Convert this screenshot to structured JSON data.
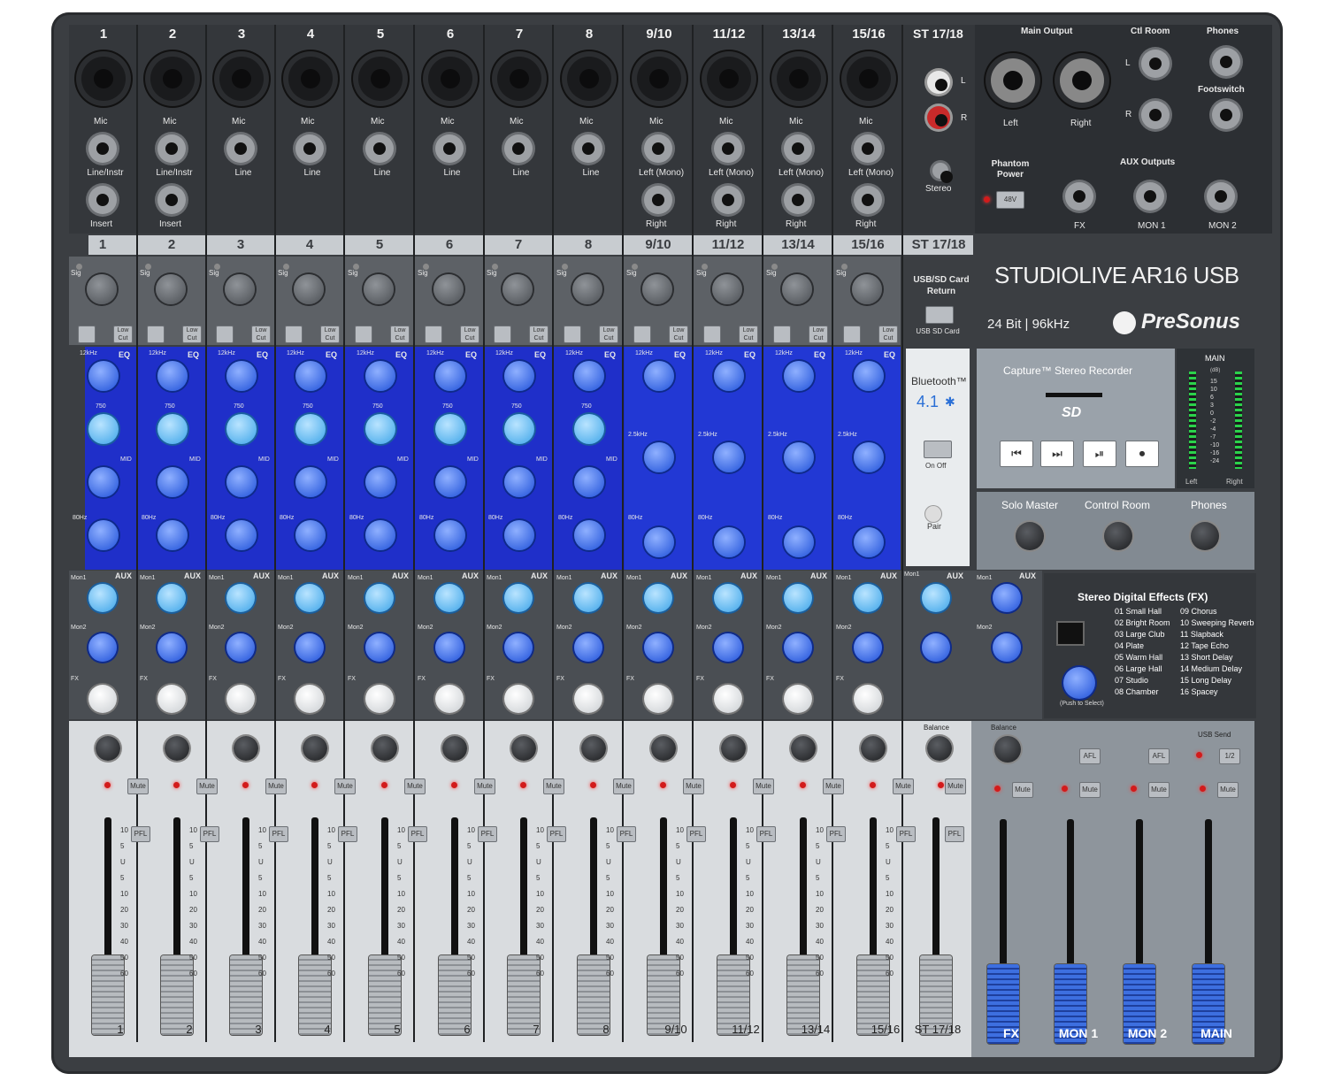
{
  "brand": {
    "model_prefix": "STUDIO",
    "model_suffix": "LIVE AR16 USB",
    "spec": "24 Bit | 96kHz",
    "maker": "PreSonus"
  },
  "channels": [
    {
      "label": "1",
      "inputs": [
        "Mic",
        "Line/Instr",
        "Insert"
      ],
      "fader": "1"
    },
    {
      "label": "2",
      "inputs": [
        "Mic",
        "Line/Instr",
        "Insert"
      ],
      "fader": "2"
    },
    {
      "label": "3",
      "inputs": [
        "Mic",
        "Line"
      ],
      "fader": "3"
    },
    {
      "label": "4",
      "inputs": [
        "Mic",
        "Line"
      ],
      "fader": "4"
    },
    {
      "label": "5",
      "inputs": [
        "Mic",
        "Line"
      ],
      "fader": "5"
    },
    {
      "label": "6",
      "inputs": [
        "Mic",
        "Line"
      ],
      "fader": "6"
    },
    {
      "label": "7",
      "inputs": [
        "Mic",
        "Line"
      ],
      "fader": "7"
    },
    {
      "label": "8",
      "inputs": [
        "Mic",
        "Line"
      ],
      "fader": "8"
    },
    {
      "label": "9/10",
      "inputs": [
        "Mic",
        "Left (Mono)",
        "Right"
      ],
      "fader": "9/10"
    },
    {
      "label": "11/12",
      "inputs": [
        "Mic",
        "Left (Mono)",
        "Right"
      ],
      "fader": "11/12"
    },
    {
      "label": "13/14",
      "inputs": [
        "Mic",
        "Left (Mono)",
        "Right"
      ],
      "fader": "13/14"
    },
    {
      "label": "15/16",
      "inputs": [
        "Mic",
        "Left (Mono)",
        "Right"
      ],
      "fader": "15/16"
    }
  ],
  "st_channel": {
    "label": "ST 17/18",
    "inputs": [
      "L",
      "R",
      "Stereo"
    ],
    "fader": "ST 17/18"
  },
  "top_right": {
    "main_output": "Main Output",
    "left": "Left",
    "right": "Right",
    "ctl_room": "Ctl Room",
    "phones": "Phones",
    "footswitch": "Footswitch",
    "phantom": "Phantom Power",
    "phantom_btn": "48V",
    "aux_outputs": "AUX Outputs",
    "fx": "FX",
    "mon1": "MON 1",
    "mon2": "MON 2",
    "l": "L",
    "r": "R"
  },
  "usb_sd": {
    "title": "USB/SD Card Return",
    "btn": "USB SD Card"
  },
  "bluetooth": {
    "title": "Bluetooth™",
    "version": "4.1",
    "on_off": "On Off",
    "pair": "Pair"
  },
  "recorder": {
    "title": "Capture™ Stereo Recorder",
    "sd": "SD"
  },
  "meter": {
    "title": "MAIN",
    "db": "(dB)",
    "left": "Left",
    "right": "Right",
    "scale": [
      "15",
      "10",
      "6",
      "3",
      "0",
      "-2",
      "-4",
      "-7",
      "-10",
      "-16",
      "-24"
    ]
  },
  "knob_row": {
    "solo": "Solo Master",
    "control": "Control Room",
    "phones": "Phones"
  },
  "fx": {
    "title": "Stereo Digital Effects (FX)",
    "push": "(Push to Select)",
    "presets": [
      "01 Small Hall",
      "02 Bright Room",
      "03 Large Club",
      "04 Plate",
      "05 Warm Hall",
      "06 Large Hall",
      "07 Studio",
      "08 Chamber",
      "09 Chorus",
      "10 Sweeping Reverb",
      "11 Slapback",
      "12 Tape Echo",
      "13 Short Delay",
      "14 Medium Delay",
      "15 Long Delay",
      "16 Spacey"
    ]
  },
  "strip": {
    "eq": "EQ",
    "aux": "AUX",
    "mon1": "Mon1",
    "mon2": "Mon2",
    "fxs": "FX",
    "hi": "12kHz",
    "mid_freq": "750",
    "lo": "80Hz",
    "hmid": "2.5kHz",
    "mid": "MID",
    "low_cut": "Low Cut",
    "mute": "Mute",
    "pfl": "PFL",
    "balance": "Balance",
    "sig": "Sig",
    "usb_send": "USB Send",
    "afl": "AFL",
    "half": "1/2"
  },
  "fader_scale": [
    "10",
    "5",
    "U",
    "5",
    "10",
    "20",
    "30",
    "40",
    "50",
    "60"
  ],
  "master_faders": [
    "FX",
    "MON 1",
    "MON 2",
    "MAIN"
  ]
}
